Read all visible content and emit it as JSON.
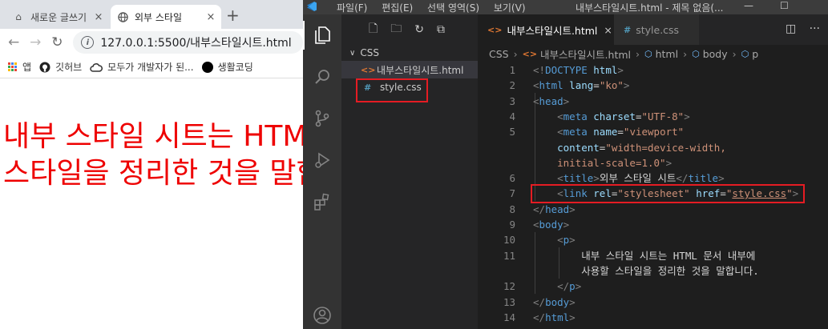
{
  "browser": {
    "tabs": [
      {
        "title": "새로운 글쓰기",
        "close": "×"
      },
      {
        "title": "외부 스타일",
        "close": "×"
      }
    ],
    "new_tab": "+",
    "url": "127.0.0.1:5500/내부스타일시트.html",
    "bookmarks": [
      "앱",
      "깃허브",
      "모두가 개발자가 된...",
      "생활코딩"
    ],
    "page_text": "내부 스타일 시트는 HTML 문서 내부에 사용할 스타일을 정리한 것을 말합니다."
  },
  "vscode": {
    "menu": [
      "파일(F)",
      "편집(E)",
      "선택 영역(S)",
      "보기(V)"
    ],
    "window_title": "내부스타일시트.html - 제목 없음(...",
    "window_controls": [
      "—",
      "☐"
    ],
    "explorer": {
      "folder": "CSS",
      "files": [
        {
          "name": "내부스타일시트.html",
          "icon": "<>"
        },
        {
          "name": "style.css",
          "icon": "#"
        }
      ]
    },
    "editor_tabs": [
      {
        "name": "내부스타일시트.html",
        "icon": "<>",
        "close": "×"
      },
      {
        "name": "style.css",
        "icon": "#"
      }
    ],
    "breadcrumb": [
      "CSS",
      "내부스타일시트.html",
      "html",
      "body",
      "p"
    ],
    "code_lines": [
      {
        "n": "1",
        "tokens": [
          [
            "br",
            "<!"
          ],
          [
            "tg",
            "DOCTYPE"
          ],
          [
            "tx",
            " "
          ],
          [
            "at",
            "html"
          ],
          [
            "br",
            ">"
          ]
        ]
      },
      {
        "n": "2",
        "tokens": [
          [
            "br",
            "<"
          ],
          [
            "tg",
            "html"
          ],
          [
            "tx",
            " "
          ],
          [
            "at",
            "lang"
          ],
          [
            "tx",
            "="
          ],
          [
            "vl",
            "\"ko\""
          ],
          [
            "br",
            ">"
          ]
        ]
      },
      {
        "n": "3",
        "tokens": [
          [
            "br",
            "<"
          ],
          [
            "tg",
            "head"
          ],
          [
            "br",
            ">"
          ]
        ]
      },
      {
        "n": "4",
        "tokens": [
          [
            "tx",
            "    "
          ],
          [
            "br",
            "<"
          ],
          [
            "tg",
            "meta"
          ],
          [
            "tx",
            " "
          ],
          [
            "at",
            "charset"
          ],
          [
            "tx",
            "="
          ],
          [
            "vl",
            "\"UTF-8\""
          ],
          [
            "br",
            ">"
          ]
        ]
      },
      {
        "n": "5",
        "tokens": [
          [
            "tx",
            "    "
          ],
          [
            "br",
            "<"
          ],
          [
            "tg",
            "meta"
          ],
          [
            "tx",
            " "
          ],
          [
            "at",
            "name"
          ],
          [
            "tx",
            "="
          ],
          [
            "vl",
            "\"viewport\""
          ]
        ]
      },
      {
        "n": "",
        "tokens": [
          [
            "tx",
            "    "
          ],
          [
            "at",
            "content"
          ],
          [
            "tx",
            "="
          ],
          [
            "vl",
            "\"width=device-width,"
          ]
        ]
      },
      {
        "n": "",
        "tokens": [
          [
            "tx",
            "    "
          ],
          [
            "vl",
            "initial-scale=1.0\""
          ],
          [
            "br",
            ">"
          ]
        ]
      },
      {
        "n": "6",
        "tokens": [
          [
            "tx",
            "    "
          ],
          [
            "br",
            "<"
          ],
          [
            "tg",
            "title"
          ],
          [
            "br",
            ">"
          ],
          [
            "tx",
            "외부 스타일 시트"
          ],
          [
            "br",
            "</"
          ],
          [
            "tg",
            "title"
          ],
          [
            "br",
            ">"
          ]
        ]
      },
      {
        "n": "7",
        "tokens": [
          [
            "tx",
            "    "
          ],
          [
            "br",
            "<"
          ],
          [
            "tg",
            "link"
          ],
          [
            "tx",
            " "
          ],
          [
            "at",
            "rel"
          ],
          [
            "tx",
            "="
          ],
          [
            "vl",
            "\"stylesheet\""
          ],
          [
            "tx",
            " "
          ],
          [
            "at",
            "href"
          ],
          [
            "tx",
            "="
          ],
          [
            "vl",
            "\""
          ],
          [
            "vlu",
            "style.css"
          ],
          [
            "vl",
            "\""
          ],
          [
            "br",
            ">"
          ]
        ]
      },
      {
        "n": "8",
        "tokens": [
          [
            "br",
            "</"
          ],
          [
            "tg",
            "head"
          ],
          [
            "br",
            ">"
          ]
        ]
      },
      {
        "n": "9",
        "tokens": [
          [
            "br",
            "<"
          ],
          [
            "tg",
            "body"
          ],
          [
            "br",
            ">"
          ]
        ]
      },
      {
        "n": "10",
        "tokens": [
          [
            "tx",
            "    "
          ],
          [
            "br",
            "<"
          ],
          [
            "tg",
            "p"
          ],
          [
            "br",
            ">"
          ]
        ]
      },
      {
        "n": "11",
        "tokens": [
          [
            "tx",
            "        내부 스타일 시트는 HTML 문서 내부에"
          ]
        ]
      },
      {
        "n": "",
        "tokens": [
          [
            "tx",
            "        사용할 스타일을 정리한 것을 말합니다."
          ]
        ]
      },
      {
        "n": "12",
        "tokens": [
          [
            "tx",
            "    "
          ],
          [
            "br",
            "</"
          ],
          [
            "tg",
            "p"
          ],
          [
            "br",
            ">"
          ]
        ]
      },
      {
        "n": "13",
        "tokens": [
          [
            "br",
            "</"
          ],
          [
            "tg",
            "body"
          ],
          [
            "br",
            ">"
          ]
        ]
      },
      {
        "n": "14",
        "tokens": [
          [
            "br",
            "</"
          ],
          [
            "tg",
            "html"
          ],
          [
            "br",
            ">"
          ]
        ]
      }
    ]
  }
}
